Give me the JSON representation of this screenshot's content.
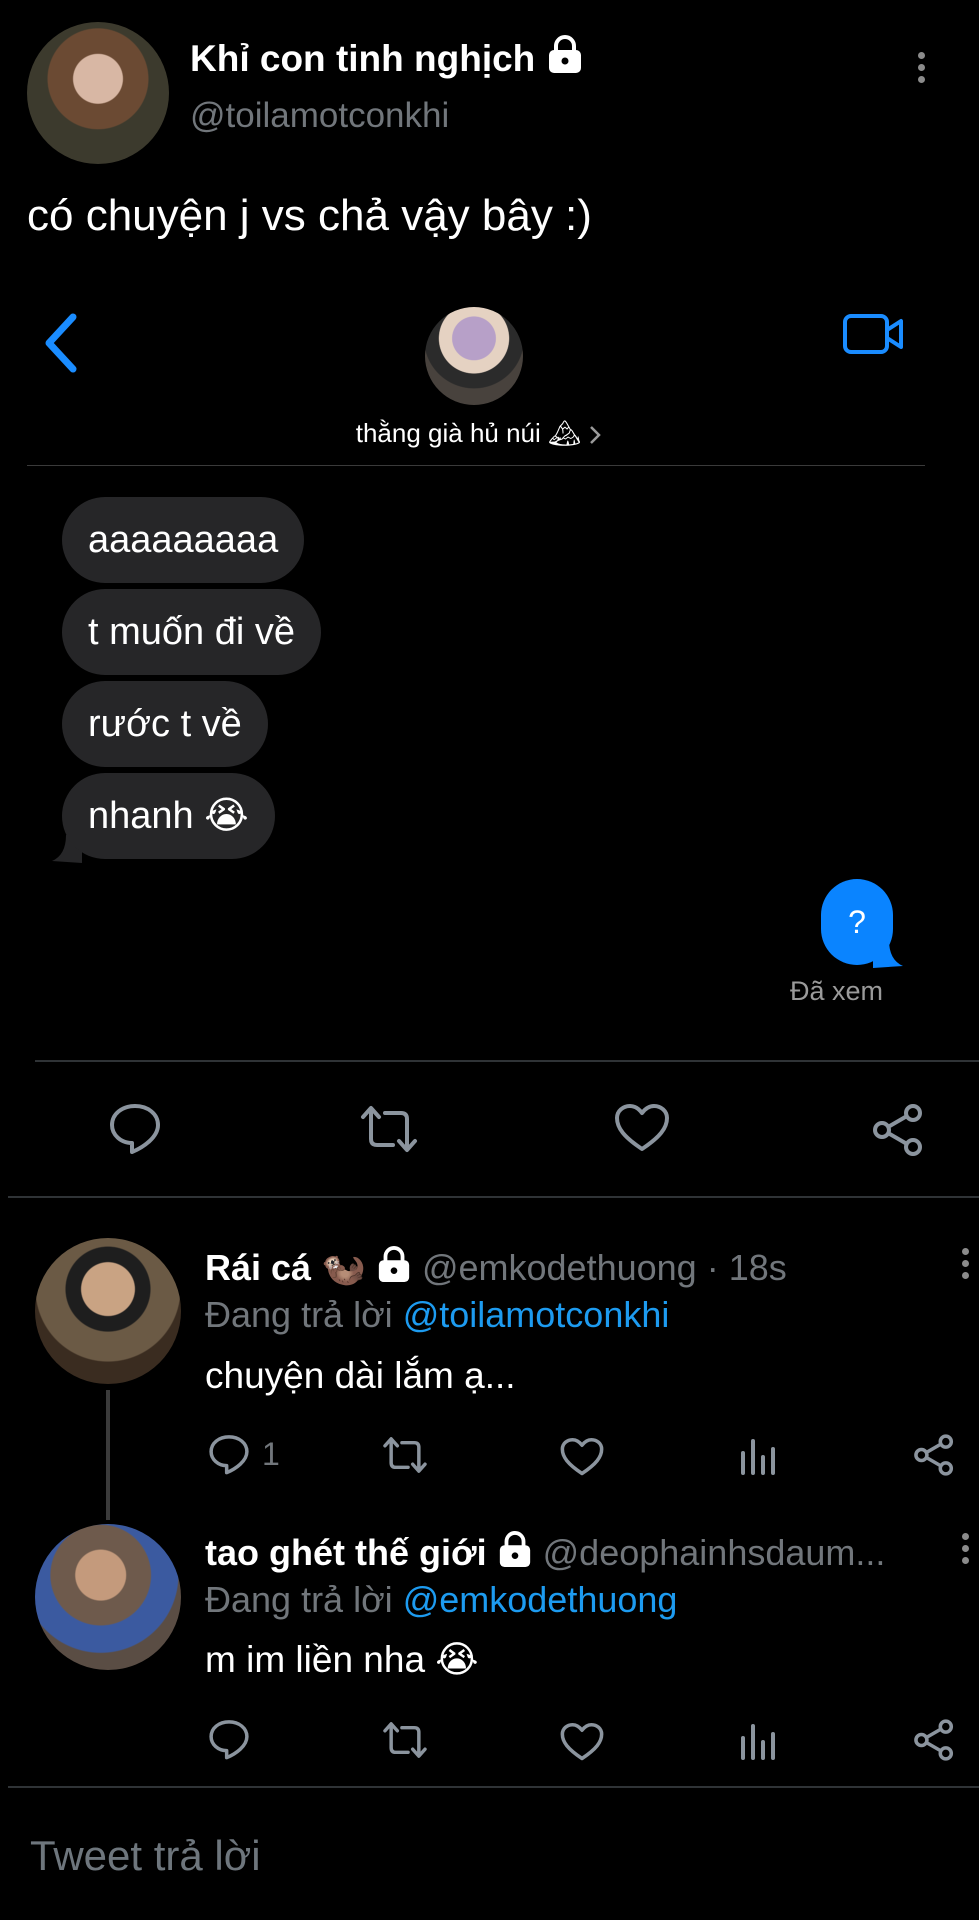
{
  "tweet": {
    "author_name": "Khỉ con tinh nghịch",
    "author_handle": "@toilamotconkhi",
    "text": "có chuyện j vs chả vậy bây :)"
  },
  "screenshot": {
    "contact_name": "thằng già hủ núi",
    "contact_emoji": "🏔",
    "messages_in": [
      "aaaaaaaaa",
      "t muốn đi về",
      "rước t về",
      "nhanh 😭"
    ],
    "message_out": "?",
    "seen_label": "Đã xem"
  },
  "replies": [
    {
      "name": "Rái cá",
      "emoji": "🦦",
      "handle": "@emkodethuong",
      "time": "· 18s",
      "replying_prefix": "Đang trả lời",
      "replying_to": "@toilamotconkhi",
      "text": "chuyện dài lắm ạ...",
      "reply_count": "1"
    },
    {
      "name": "tao ghét thế giới",
      "handle": "@deophainhsdaum...",
      "replying_prefix": "Đang trả lời",
      "replying_to": "@emkodethuong",
      "text": "m im liền nha 😭"
    }
  ],
  "compose": {
    "placeholder": "Tweet trả lời"
  },
  "colors": {
    "accent": "#1d9bf0",
    "bubble_in": "#262628",
    "bubble_out": "#0a84ff",
    "divider": "#2f3336"
  }
}
